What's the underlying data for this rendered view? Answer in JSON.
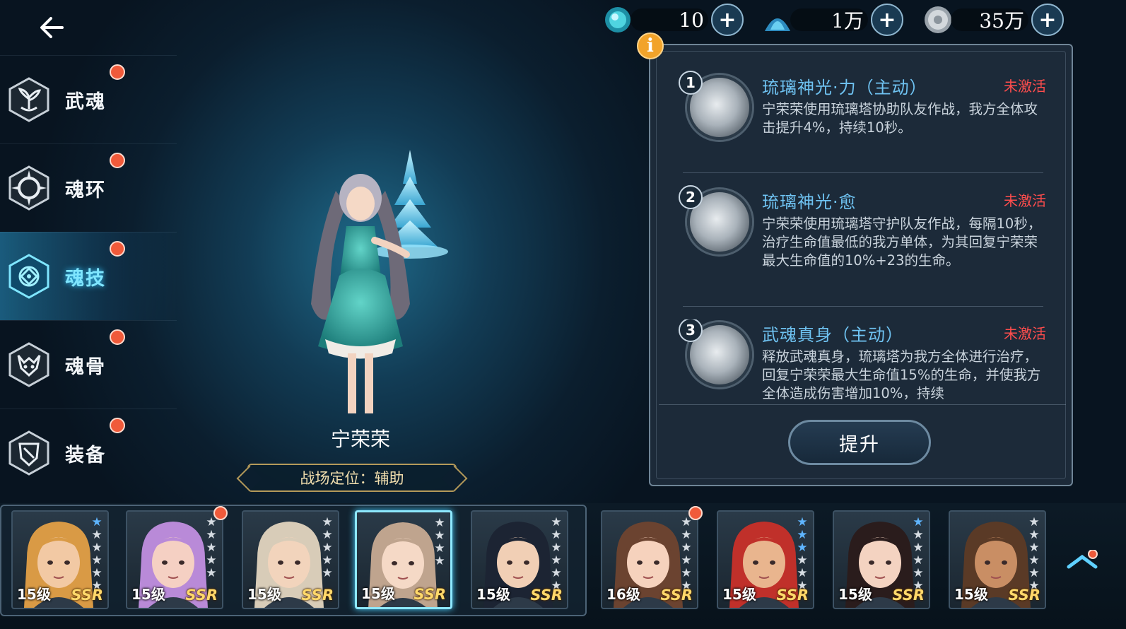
{
  "header": {
    "back_icon": "arrow-left-icon"
  },
  "currencies": [
    {
      "icon": "soul-crystal-icon",
      "value": "10",
      "color": "#4fd4e0"
    },
    {
      "icon": "blue-dust-icon",
      "value": "1万",
      "color": "#49b5e0"
    },
    {
      "icon": "silver-coin-icon",
      "value": "35万",
      "color": "#c9ced3"
    }
  ],
  "sidebar": {
    "items": [
      {
        "label": "武魂",
        "icon": "spirit-sprout-icon",
        "active": false
      },
      {
        "label": "魂环",
        "icon": "soul-ring-icon",
        "active": false
      },
      {
        "label": "魂技",
        "icon": "soul-skill-icon",
        "active": true
      },
      {
        "label": "魂骨",
        "icon": "soul-bone-icon",
        "active": false
      },
      {
        "label": "装备",
        "icon": "equipment-shield-icon",
        "active": false
      }
    ]
  },
  "character": {
    "name": "宁荣荣",
    "role": "战场定位：辅助"
  },
  "skills": [
    {
      "num": "1",
      "title": "琉璃神光·力（主动）",
      "status": "未激活",
      "desc": "宁荣荣使用琉璃塔协助队友作战，我方全体攻击提升4%，持续10秒。"
    },
    {
      "num": "2",
      "title": "琉璃神光·愈",
      "status": "未激活",
      "desc": "宁荣荣使用琉璃塔守护队友作战，每隔10秒，治疗生命值最低的我方单体，为其回复宁荣荣最大生命值的10%+23的生命。"
    },
    {
      "num": "3",
      "title": "武魂真身（主动）",
      "status": "未激活",
      "desc": "释放武魂真身，琉璃塔为我方全体进行治疗，回复宁荣荣最大生命值15%的生命，并使我方全体造成伤害增加10%，持续"
    }
  ],
  "upgrade_label": "提升",
  "info_label": "i",
  "roster": [
    {
      "level": "15级",
      "rarity": "SSR",
      "blue_stars": 1,
      "stars": 6,
      "hair": "#d99a45",
      "skin": "#f2c9a4",
      "dot": false
    },
    {
      "level": "15级",
      "rarity": "SSR",
      "blue_stars": 0,
      "stars": 5,
      "hair": "#b98ad8",
      "skin": "#f5d0c3",
      "dot": true
    },
    {
      "level": "15级",
      "rarity": "SSR",
      "blue_stars": 0,
      "stars": 5,
      "hair": "#d8ccb8",
      "skin": "#f2d4bc",
      "dot": false
    },
    {
      "level": "15级",
      "rarity": "SSR",
      "blue_stars": 0,
      "stars": 4,
      "hair": "#bfa48e",
      "skin": "#f5d9c6",
      "dot": false,
      "selected": true
    },
    {
      "level": "15级",
      "rarity": "SSR",
      "blue_stars": 0,
      "stars": 6,
      "hair": "#1c2433",
      "skin": "#f1cfb5",
      "dot": false
    },
    {
      "level": "16级",
      "rarity": "SSR",
      "blue_stars": 0,
      "stars": 6,
      "hair": "#6b4330",
      "skin": "#f6d2bd",
      "dot": true
    },
    {
      "level": "15级",
      "rarity": "SSR",
      "blue_stars": 3,
      "stars": 6,
      "hair": "#c0302a",
      "skin": "#e9b58e",
      "dot": false
    },
    {
      "level": "15级",
      "rarity": "SSR",
      "blue_stars": 1,
      "stars": 6,
      "hair": "#2a1c1c",
      "skin": "#f4d3c1",
      "dot": false
    },
    {
      "level": "15级",
      "rarity": "SSR",
      "blue_stars": 0,
      "stars": 6,
      "hair": "#5a3a26",
      "skin": "#c98e64",
      "dot": false
    }
  ]
}
